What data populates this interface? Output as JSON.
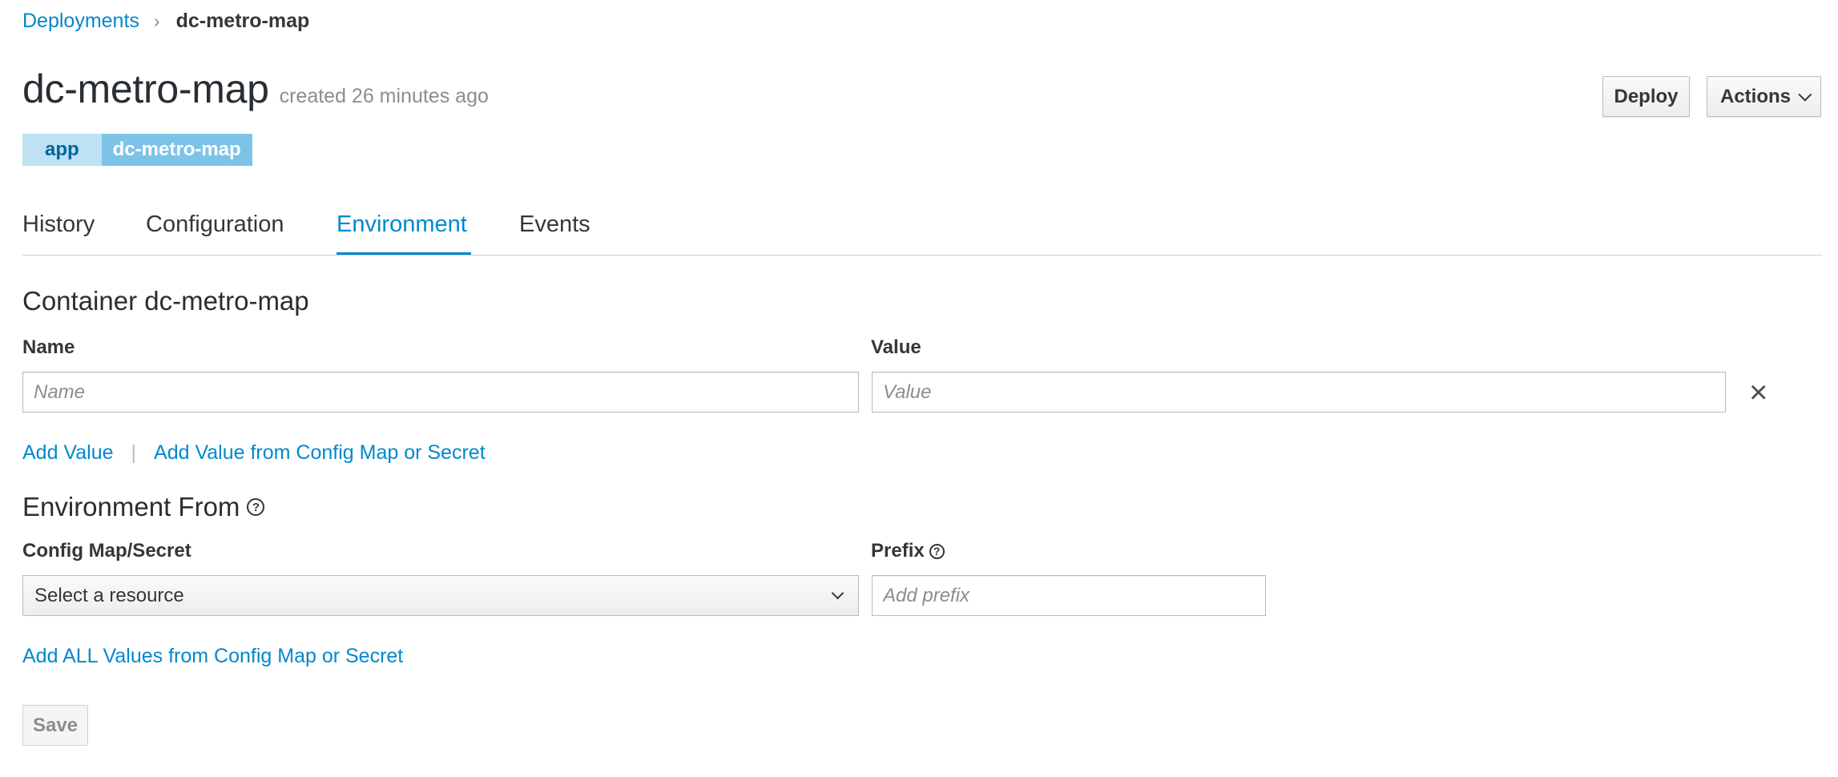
{
  "breadcrumb": {
    "parent": "Deployments",
    "separator": "›",
    "current": "dc-metro-map"
  },
  "header": {
    "title": "dc-metro-map",
    "created": "created 26 minutes ago",
    "deploy_label": "Deploy",
    "actions_label": "Actions"
  },
  "labels": [
    {
      "key": "app",
      "value": "dc-metro-map"
    }
  ],
  "tabs": [
    {
      "label": "History"
    },
    {
      "label": "Configuration"
    },
    {
      "label": "Environment"
    },
    {
      "label": "Events"
    }
  ],
  "active_tab": "Environment",
  "container": {
    "heading": "Container dc-metro-map",
    "name_label": "Name",
    "value_label": "Value",
    "name_placeholder": "Name",
    "value_placeholder": "Value",
    "remove_icon": "×",
    "add_value": "Add Value",
    "separator": "|",
    "add_value_from": "Add Value from Config Map or Secret"
  },
  "env_from": {
    "heading": "Environment From",
    "help_icon": "?",
    "config_label": "Config Map/Secret",
    "select_value": "Select a resource",
    "prefix_label": "Prefix",
    "prefix_placeholder": "Add prefix",
    "add_all": "Add ALL Values from Config Map or Secret"
  },
  "save_label": "Save",
  "colors": {
    "link": "#0088ce",
    "tag_key_bg": "#bee1f4",
    "tag_value_bg": "#7dc3e8"
  }
}
